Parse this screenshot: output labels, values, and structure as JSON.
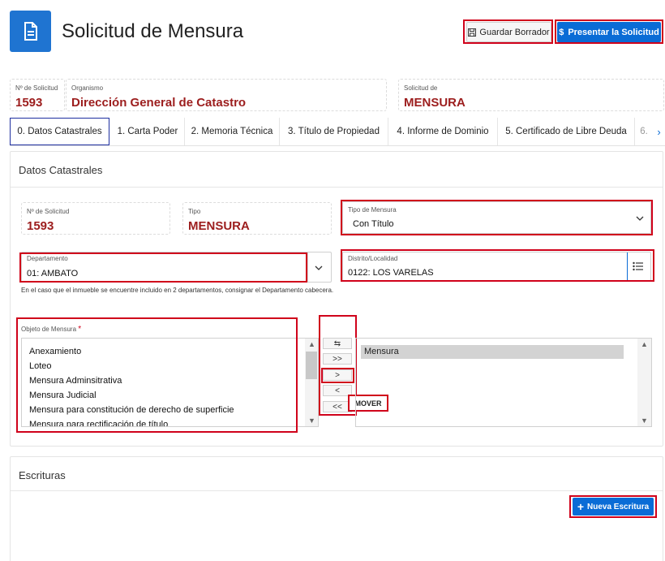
{
  "header": {
    "title": "Solicitud de Mensura",
    "save_draft_label": "Guardar Borrador",
    "submit_label": "Presentar la Solicitud",
    "save_icon": "floppy-disk-icon",
    "submit_icon": "dollar-icon"
  },
  "summary": {
    "request_no_label": "Nº de Solicitud",
    "request_no": "1593",
    "agency_label": "Organismo",
    "agency": "Dirección General de Catastro",
    "request_of_label": "Solicitud de",
    "request_of": "MENSURA"
  },
  "tabs": [
    {
      "label": "0. Datos Catastrales",
      "active": true
    },
    {
      "label": "1. Carta Poder"
    },
    {
      "label": "2. Memoria Técnica"
    },
    {
      "label": "3. Título de Propiedad"
    },
    {
      "label": "4. Informe de Dominio"
    },
    {
      "label": "5. Certificado de Libre Deuda"
    },
    {
      "label": "6."
    }
  ],
  "datos": {
    "title": "Datos Catastrales",
    "request_no_label": "Nº de Solicitud",
    "request_no": "1593",
    "type_label": "Tipo",
    "type": "MENSURA",
    "survey_type_label": "Tipo de Mensura",
    "survey_type": "Con Título",
    "department_label": "Departamento",
    "department": "01: AMBATO",
    "district_label": "Distrito/Localidad",
    "district": "0122: LOS VARELAS",
    "department_help": "En el caso que el inmueble se encuentre incluido en 2 departamentos, consignar el Departamento cabecera.",
    "object_label": "Objeto de Mensura",
    "required_mark": "*",
    "available_options": [
      "Anexamiento",
      "Loteo",
      "Mensura Adminsitrativa",
      "Mensura Judicial",
      "Mensura para constitución de derecho de superficie",
      "Mensura para rectificación de título"
    ],
    "selected_options": [
      "Mensura"
    ],
    "shuttle_buttons": {
      "reset": "⇆",
      "move_all": ">>",
      "move": ">",
      "remove": "<",
      "remove_all": "<<"
    },
    "move_annotation": "MOVER"
  },
  "escrituras": {
    "title": "Escrituras",
    "new_label": "Nueva Escritura",
    "new_icon": "plus-icon"
  },
  "colors": {
    "primary": "#0a6cd6",
    "value_red": "#9c1d1d",
    "annotation_red": "#d0021b"
  }
}
